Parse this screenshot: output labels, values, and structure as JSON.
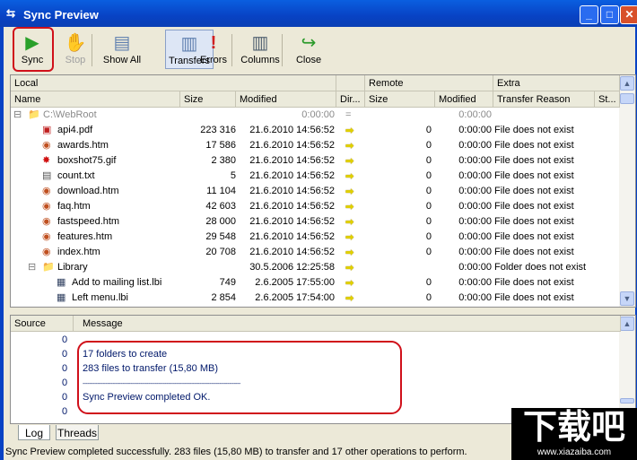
{
  "window": {
    "title": "Sync Preview",
    "minimize": "_",
    "maximize": "□",
    "close": "✕"
  },
  "toolbar": [
    {
      "label": "Sync",
      "icon": "play-icon"
    },
    {
      "label": "Stop",
      "icon": "hand-icon",
      "disabled": true
    },
    {
      "label": "Show All",
      "icon": "pages-icon"
    },
    {
      "label": "Transfers",
      "icon": "transfers-icon",
      "active": true
    },
    {
      "label": "Errors",
      "icon": "exclamation-icon"
    },
    {
      "label": "Columns",
      "icon": "columns-icon"
    },
    {
      "label": "Close",
      "icon": "green-arrow-icon"
    }
  ],
  "groups": {
    "local": "Local",
    "remote": "Remote",
    "extra": "Extra"
  },
  "columns": [
    "Name",
    "Size",
    "Modified",
    "Dir...",
    "Size",
    "Modified",
    "Transfer Reason",
    "St..."
  ],
  "rows": [
    {
      "level": 0,
      "type": "folder",
      "name": "C:\\WebRoot",
      "size": "",
      "modified": "0:00:00",
      "dir": "=",
      "rsize": "",
      "rmod": "0:00:00",
      "reason": "",
      "gray": true
    },
    {
      "level": 1,
      "type": "pdf",
      "name": "api4.pdf",
      "size": "223 316",
      "modified": "21.6.2010 14:56:52",
      "dir": "➡",
      "rsize": "0",
      "rmod": "0:00:00",
      "reason": "File does not exist"
    },
    {
      "level": 1,
      "type": "htm",
      "name": "awards.htm",
      "size": "17 586",
      "modified": "21.6.2010 14:56:52",
      "dir": "➡",
      "rsize": "0",
      "rmod": "0:00:00",
      "reason": "File does not exist"
    },
    {
      "level": 1,
      "type": "gif",
      "name": "boxshot75.gif",
      "size": "2 380",
      "modified": "21.6.2010 14:56:52",
      "dir": "➡",
      "rsize": "0",
      "rmod": "0:00:00",
      "reason": "File does not exist"
    },
    {
      "level": 1,
      "type": "txt",
      "name": "count.txt",
      "size": "5",
      "modified": "21.6.2010 14:56:52",
      "dir": "➡",
      "rsize": "0",
      "rmod": "0:00:00",
      "reason": "File does not exist"
    },
    {
      "level": 1,
      "type": "htm",
      "name": "download.htm",
      "size": "11 104",
      "modified": "21.6.2010 14:56:52",
      "dir": "➡",
      "rsize": "0",
      "rmod": "0:00:00",
      "reason": "File does not exist"
    },
    {
      "level": 1,
      "type": "htm",
      "name": "faq.htm",
      "size": "42 603",
      "modified": "21.6.2010 14:56:52",
      "dir": "➡",
      "rsize": "0",
      "rmod": "0:00:00",
      "reason": "File does not exist"
    },
    {
      "level": 1,
      "type": "htm",
      "name": "fastspeed.htm",
      "size": "28 000",
      "modified": "21.6.2010 14:56:52",
      "dir": "➡",
      "rsize": "0",
      "rmod": "0:00:00",
      "reason": "File does not exist"
    },
    {
      "level": 1,
      "type": "htm",
      "name": "features.htm",
      "size": "29 548",
      "modified": "21.6.2010 14:56:52",
      "dir": "➡",
      "rsize": "0",
      "rmod": "0:00:00",
      "reason": "File does not exist"
    },
    {
      "level": 1,
      "type": "htm",
      "name": "index.htm",
      "size": "20 708",
      "modified": "21.6.2010 14:56:52",
      "dir": "➡",
      "rsize": "0",
      "rmod": "0:00:00",
      "reason": "File does not exist"
    },
    {
      "level": 1,
      "type": "folder",
      "name": "Library",
      "size": "",
      "modified": "30.5.2006 12:25:58",
      "dir": "➡",
      "rsize": "",
      "rmod": "0:00:00",
      "reason": "Folder does not exist"
    },
    {
      "level": 2,
      "type": "lbi",
      "name": "Add to mailing list.lbi",
      "size": "749",
      "modified": "2.6.2005 17:55:00",
      "dir": "➡",
      "rsize": "0",
      "rmod": "0:00:00",
      "reason": "File does not exist"
    },
    {
      "level": 2,
      "type": "lbi",
      "name": "Left menu.lbi",
      "size": "2 854",
      "modified": "2.6.2005 17:54:00",
      "dir": "➡",
      "rsize": "0",
      "rmod": "0:00:00",
      "reason": "File does not exist"
    }
  ],
  "log": {
    "columns": [
      "Source",
      "Message"
    ],
    "sources": [
      "0",
      "0",
      "0",
      "0",
      "0",
      "0"
    ],
    "messages": [
      "",
      "17 folders to create",
      "283 files to transfer (15,80 MB)",
      "------------------------------------------------------------------------------------------------",
      "Sync Preview completed OK.",
      ""
    ]
  },
  "tabs": [
    {
      "label": "Log",
      "active": true
    },
    {
      "label": "Threads"
    }
  ],
  "status": "Sync Preview completed successfully. 283 files (15,80 MB) to transfer and 17 other operations to perform.",
  "watermark": {
    "text": "下载吧",
    "url": "www.xiazaiba.com"
  }
}
